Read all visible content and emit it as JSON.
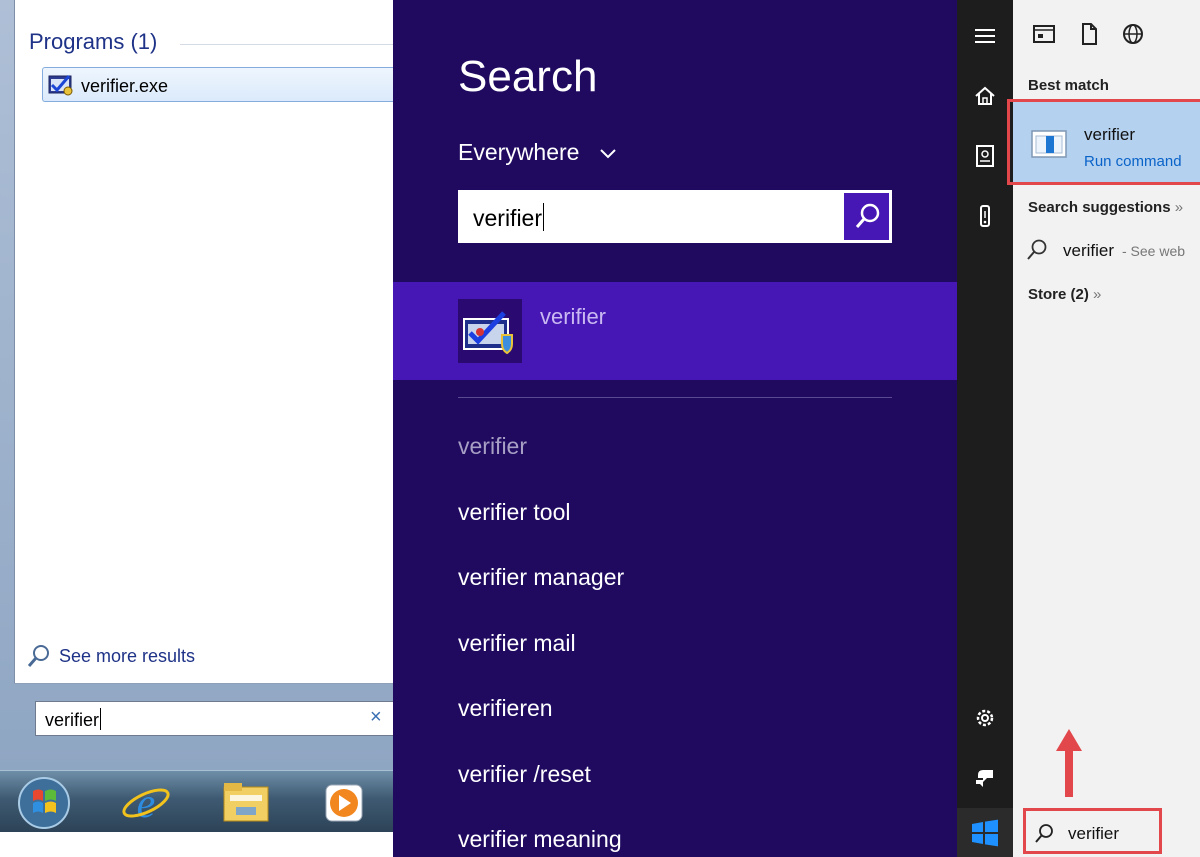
{
  "win7": {
    "programs_heading": "Programs (1)",
    "result_label": "verifier.exe",
    "see_more": "See more results",
    "search_value": "verifier",
    "clear_glyph": "×",
    "taskbar": [
      "start-orb-icon",
      "internet-explorer-icon",
      "file-explorer-icon",
      "media-player-icon"
    ]
  },
  "win8": {
    "title": "Search",
    "scope": "Everywhere",
    "search_value": "verifier",
    "highlight_label": "verifier",
    "suggestions": [
      "verifier",
      "verifier tool",
      "verifier manager",
      "verifier mail",
      "verifieren",
      "verifier /reset",
      "verifier meaning"
    ],
    "colors": {
      "background": "#1f0a60",
      "accent": "#4617b4"
    }
  },
  "win10": {
    "best_match_heading": "Best match",
    "best_match_name": "verifier",
    "best_match_type": "Run command",
    "suggestions_heading": "Search suggestions",
    "suggestions_arrow": "»",
    "web_term": "verifier",
    "web_hint": "- See web",
    "store_heading": "Store (2)",
    "store_arrow": "»",
    "search_value": "verifier",
    "colors": {
      "highlight": "#b4d1ef",
      "annotation": "#e2474b",
      "link": "#0a63c9"
    }
  }
}
